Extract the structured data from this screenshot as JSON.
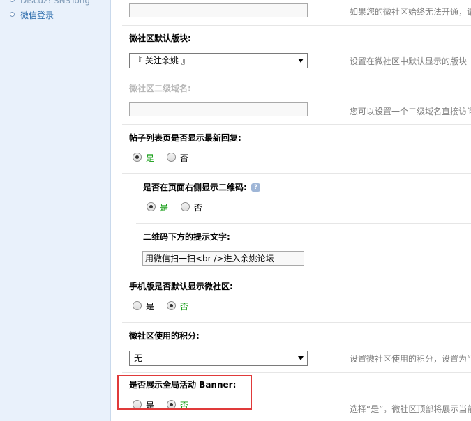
{
  "sidebar": {
    "items": [
      {
        "label": "Discuz! SNSTong"
      },
      {
        "label": "微信登录"
      }
    ]
  },
  "fields": {
    "top_input": {
      "value": "",
      "help": "如果您的微社区始终无法开通，请"
    },
    "default_board": {
      "label": "微社区默认版块:",
      "selected": "『 关注余姚 』",
      "help": "设置在微社区中默认显示的版块"
    },
    "subdomain": {
      "label": "微社区二级域名:",
      "value": "",
      "help": "您可以设置一个二级域名直接访问"
    },
    "show_latest_reply": {
      "label": "帖子列表页是否显示最新回复:",
      "yes": "是",
      "no": "否",
      "value": "yes"
    },
    "show_qrcode": {
      "label": "是否在页面右侧显示二维码:",
      "help_icon": "?",
      "yes": "是",
      "no": "否",
      "value": "yes"
    },
    "qrcode_tip": {
      "label": "二维码下方的提示文字:",
      "value": "用微信扫一扫<br />进入余姚论坛"
    },
    "mobile_default": {
      "label": "手机版是否默认显示微社区:",
      "yes": "是",
      "no": "否",
      "value": "no"
    },
    "credits": {
      "label": "微社区使用的积分:",
      "selected": "无",
      "help": "设置微社区使用的积分，设置为“"
    },
    "banner": {
      "label": "是否展示全局活动 Banner:",
      "yes": "是",
      "no": "否",
      "value": "no",
      "help": "选择“是”，微社区顶部将展示当前"
    }
  },
  "colors": {
    "sidebar_bg": "#e9f1fb",
    "link": "#2366a8",
    "selected_text": "#109b10",
    "highlight_border": "#e03a3a"
  }
}
